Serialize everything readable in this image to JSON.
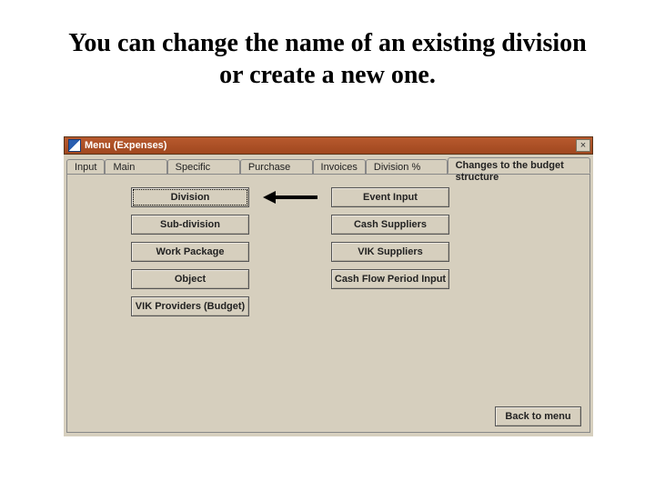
{
  "heading": "You can change the name of an existing division or create a new one.",
  "window": {
    "title": "Menu (Expenses)",
    "close": "×"
  },
  "tabs": [
    {
      "label": "Input"
    },
    {
      "label": "Main reports"
    },
    {
      "label": "Specific reports"
    },
    {
      "label": "Purchase order"
    },
    {
      "label": "Invoices"
    },
    {
      "label": "Division % criteria"
    },
    {
      "label": "Changes to the budget structure"
    }
  ],
  "buttons": {
    "left": [
      {
        "label": "Division"
      },
      {
        "label": "Sub-division"
      },
      {
        "label": "Work Package"
      },
      {
        "label": "Object"
      },
      {
        "label": "VIK Providers (Budget)"
      }
    ],
    "right": [
      {
        "label": "Event Input"
      },
      {
        "label": "Cash Suppliers"
      },
      {
        "label": "VIK Suppliers"
      },
      {
        "label": "Cash Flow Period Input"
      }
    ],
    "back": "Back to menu"
  }
}
